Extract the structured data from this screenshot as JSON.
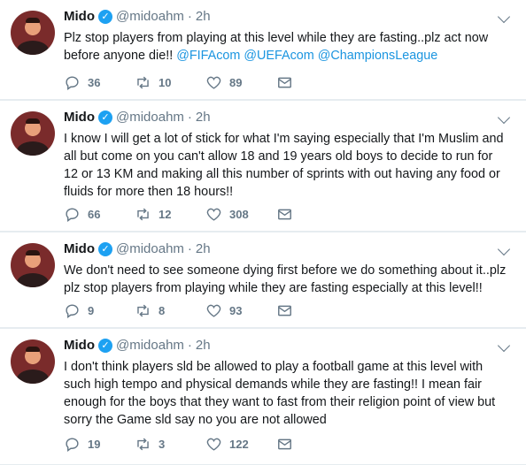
{
  "tweets": [
    {
      "name": "Mido",
      "handle": "@midoahm",
      "dot": "·",
      "time": "2h",
      "text_parts": [
        "Plz stop players from playing at this level while they are fasting..plz act now before anyone die!! "
      ],
      "mentions": [
        "@FIFAcom",
        "@UEFAcom",
        "@ChampionsLeague"
      ],
      "replies": "36",
      "retweets": "10",
      "likes": "89"
    },
    {
      "name": "Mido",
      "handle": "@midoahm",
      "dot": "·",
      "time": "2h",
      "text_parts": [
        "I know I will get a lot of stick for what I'm saying especially that I'm Muslim and all but come on you can't allow 18 and 19 years old boys to decide to run for 12 or 13 KM and making all this number of sprints with out having any food or fluids for more then 18 hours!!"
      ],
      "mentions": [],
      "replies": "66",
      "retweets": "12",
      "likes": "308"
    },
    {
      "name": "Mido",
      "handle": "@midoahm",
      "dot": "·",
      "time": "2h",
      "text_parts": [
        "We don't need to see someone dying first before we do something about it..plz plz stop players from playing while they are fasting especially at this level!!"
      ],
      "mentions": [],
      "replies": "9",
      "retweets": "8",
      "likes": "93"
    },
    {
      "name": "Mido",
      "handle": "@midoahm",
      "dot": "·",
      "time": "2h",
      "text_parts": [
        "I don't think players sld be allowed to play a football game at this level with such high tempo and physical demands while they are fasting!! I mean fair enough for the boys that they want to fast from their religion point of view but sorry the Game sld say no you are not allowed"
      ],
      "mentions": [],
      "replies": "19",
      "retweets": "3",
      "likes": "122"
    }
  ],
  "icons": {
    "verified": "verified-badge-icon",
    "caret": "chevron-down-icon",
    "reply": "reply-icon",
    "retweet": "retweet-icon",
    "like": "heart-icon",
    "dm": "envelope-icon"
  },
  "colors": {
    "accent": "#1da1f2",
    "link": "#1b95e0",
    "muted": "#657786",
    "background": "#e6ecf0"
  }
}
